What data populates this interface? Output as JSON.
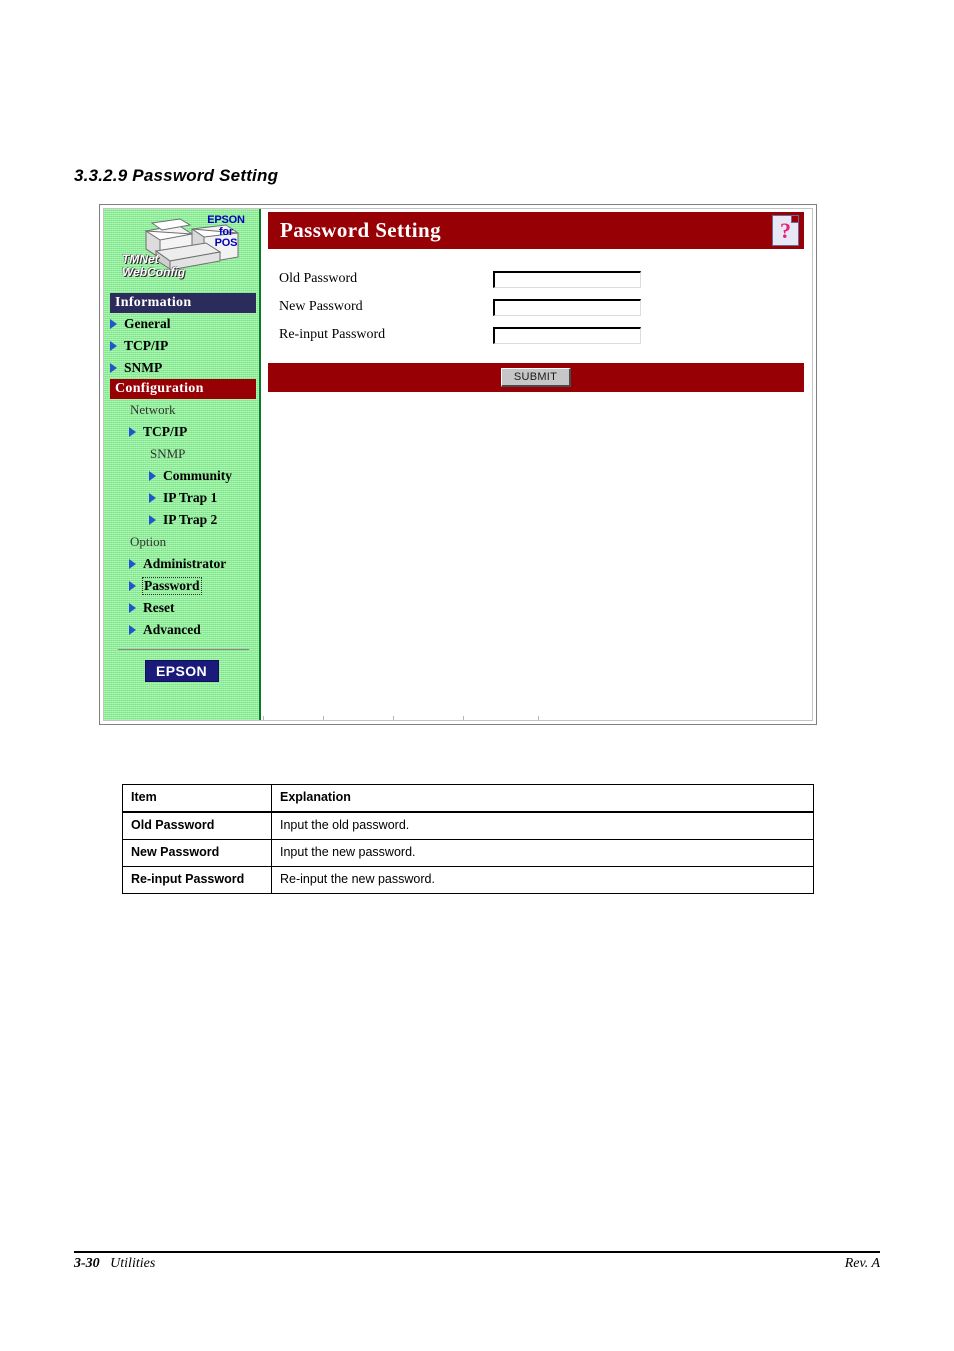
{
  "document": {
    "section_heading": "3.3.2.9 Password Setting",
    "footer_page": "3-30",
    "footer_chapter": "Utilities",
    "footer_revision": "Rev. A"
  },
  "webconfig": {
    "sidebar": {
      "logo": {
        "brand_line1": "EPSON",
        "brand_line2": "for",
        "brand_line3": "POS",
        "product_line1": "TMNet",
        "product_line2": "WebConfig",
        "icon": "printer-illustration"
      },
      "sections": [
        {
          "bar_label": "Information",
          "bar_color": "#2b2b5c",
          "items": [
            {
              "label": "General",
              "level": 1,
              "arrow": true,
              "group": false,
              "current": false
            },
            {
              "label": "TCP/IP",
              "level": 1,
              "arrow": true,
              "group": false,
              "current": false
            },
            {
              "label": "SNMP",
              "level": 1,
              "arrow": true,
              "group": false,
              "current": false
            }
          ]
        },
        {
          "bar_label": "Configuration",
          "bar_color": "#970005",
          "items": [
            {
              "label": "Network",
              "level": 1,
              "arrow": false,
              "group": true,
              "current": false
            },
            {
              "label": "TCP/IP",
              "level": 2,
              "arrow": true,
              "group": false,
              "current": false
            },
            {
              "label": "SNMP",
              "level": 2,
              "arrow": false,
              "group": true,
              "current": false
            },
            {
              "label": "Community",
              "level": 3,
              "arrow": true,
              "group": false,
              "current": false
            },
            {
              "label": "IP Trap 1",
              "level": 3,
              "arrow": true,
              "group": false,
              "current": false
            },
            {
              "label": "IP Trap 2",
              "level": 3,
              "arrow": true,
              "group": false,
              "current": false
            },
            {
              "label": "Option",
              "level": 1,
              "arrow": false,
              "group": true,
              "current": false
            },
            {
              "label": "Administrator",
              "level": 2,
              "arrow": true,
              "group": false,
              "current": false
            },
            {
              "label": "Password",
              "level": 2,
              "arrow": true,
              "group": false,
              "current": true
            },
            {
              "label": "Reset",
              "level": 2,
              "arrow": true,
              "group": false,
              "current": false
            },
            {
              "label": "Advanced",
              "level": 2,
              "arrow": true,
              "group": false,
              "current": false
            }
          ]
        }
      ],
      "footer_logo": "EPSON"
    },
    "main": {
      "title": "Password Setting",
      "help_icon": "help-question-page-icon",
      "help_glyph": "?",
      "fields": [
        {
          "label": "Old Password",
          "value": "",
          "placeholder": ""
        },
        {
          "label": "New Password",
          "value": "",
          "placeholder": ""
        },
        {
          "label": "Re-input Password",
          "value": "",
          "placeholder": ""
        }
      ],
      "submit_label": "SUBMIT"
    }
  },
  "explanation_table": {
    "headers": [
      "Item",
      "Explanation"
    ],
    "rows": [
      [
        "Old Password",
        "Input the old password."
      ],
      [
        "New Password",
        "Input the new password."
      ],
      [
        "Re-input Password",
        "Re-input the new password."
      ]
    ]
  },
  "colors": {
    "title_bar_red": "#970005",
    "information_navy": "#2b2b5c",
    "sidebar_green": "#97ef8f",
    "arrow_blue": "#2255cc",
    "help_pink": "#e6217f"
  }
}
